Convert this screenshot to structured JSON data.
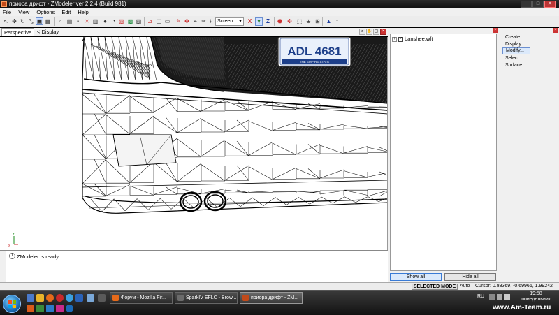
{
  "window": {
    "title": "приора дрифт - ZModeler ver 2.2.4 (Build 981)",
    "controls": [
      "_",
      "□",
      "X"
    ]
  },
  "menu": [
    "File",
    "View",
    "Options",
    "Edit",
    "Help"
  ],
  "toolbar": {
    "coord_system": "Screen",
    "axes": [
      "X",
      "Y",
      "Z"
    ]
  },
  "viewport": {
    "tab_label": "Perspective",
    "display_label": "Display",
    "display_arrow": "<",
    "plate_text": "ADL 4681",
    "plate_footer": "THE EMPIRE STATE"
  },
  "log": {
    "message": "ZModeler is ready."
  },
  "tree": {
    "expander": "+",
    "item_label": "banshee.wft",
    "show_all": "Show all",
    "hide_all": "Hide all"
  },
  "commands": [
    "Create...",
    "Display...",
    "Modify...",
    "Select...",
    "Surface..."
  ],
  "commands_selected": "Modify...",
  "status": {
    "mode": "SELECTED MODE",
    "auto": "Auto",
    "cursor": "Cursor: 0.88369, -0.69966, 1.99242"
  },
  "taskbar": {
    "tasks": [
      {
        "label": "Форум - Mozilla Fir...",
        "icon_color": "#e66a1a"
      },
      {
        "label": "SparkIV EFLC - Brow...",
        "icon_color": "#6b6b6b"
      },
      {
        "label": "приора дрифт - ZM...",
        "icon_color": "#c04a1a"
      }
    ],
    "language": "RU",
    "time": "19:58",
    "day": "понедельник"
  },
  "watermark": "www.Am-Team.ru",
  "colors": {
    "accent": "#6b8fd0",
    "close": "#cc3333",
    "plate_blue": "#1d3f8a"
  }
}
